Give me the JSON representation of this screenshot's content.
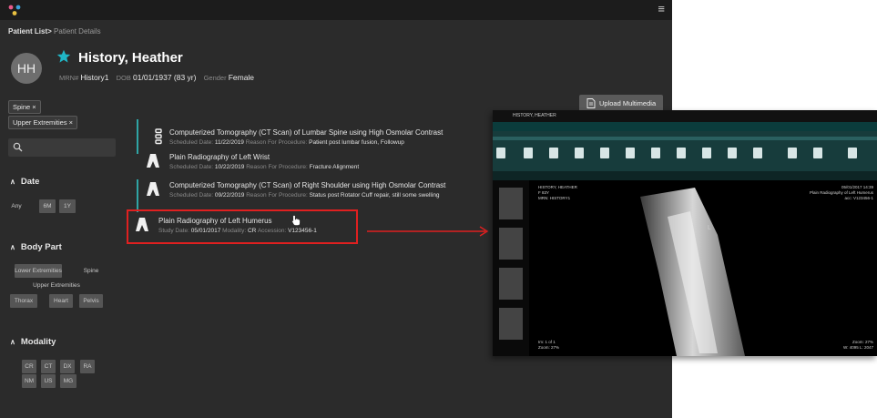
{
  "header": {
    "menu_icon": "hamburger-menu-icon",
    "logo_icon": "app-logo-icon"
  },
  "breadcrumb": {
    "link": "Patient List",
    "separator": ">",
    "current": "Patient Details"
  },
  "patient": {
    "initials": "HH",
    "name": "History, Heather",
    "mrn_label": "MRN#",
    "mrn": "History1",
    "dob_label": "DOB",
    "dob": "01/01/1937 (83 yr)",
    "gender_label": "Gender",
    "gender": "Female"
  },
  "filters": {
    "chips": [
      "Spine ×",
      "Upper Extremities ×"
    ],
    "date": {
      "title": "Date",
      "options": [
        "Any",
        "6M",
        "1Y"
      ]
    },
    "body_part": {
      "title": "Body Part",
      "options": [
        "Lower Extremities",
        "Spine",
        "Upper Extremities",
        "Thorax",
        "Heart",
        "Pelvis"
      ]
    },
    "modality": {
      "title": "Modality",
      "options": [
        "CR",
        "CT",
        "DX",
        "RA",
        "NM",
        "US",
        "MG"
      ]
    }
  },
  "upload_button": "Upload Multimedia",
  "studies": [
    {
      "title": "Computerized Tomography (CT Scan) of Lumbar Spine using High Osmolar Contrast",
      "label1": "Scheduled Date:",
      "value1": "11/22/2019",
      "label2": "Reason For Procedure:",
      "value2": "Patient post lumbar fusion, Followup"
    },
    {
      "title": "Plain Radiography of Left Wrist",
      "label1": "Scheduled Date:",
      "value1": "10/22/2019",
      "label2": "Reason For Procedure:",
      "value2": "Fracture Alignment"
    },
    {
      "title": "Computerized Tomography (CT Scan) of Right Shoulder using High Osmolar Contrast",
      "label1": "Scheduled Date:",
      "value1": "09/22/2019",
      "label2": "Reason For Procedure:",
      "value2": "Status post Rotator Cuff repair, still some swelling"
    },
    {
      "title": "Plain Radiography of Left Humerus",
      "label1": "Study Date:",
      "value1": "05/01/2017",
      "label2": "Modality:",
      "value2": "CR",
      "label3": "Accession:",
      "value3": "V123456-1"
    }
  ],
  "viewer": {
    "patient_tab": "HISTORY, HEATHER",
    "overlay_left": [
      "HISTORY, HEATHER",
      "F 83Y",
      "MRN: HISTORY1"
    ],
    "overlay_right": [
      "05/01/2017 14:39",
      "Plain Radiography of Left Humerus",
      "acc: V123456-1"
    ],
    "marker": "L",
    "bottom_left": [
      "Im: 1 of 1",
      "Zoom: 27%"
    ],
    "bottom_right": [
      "Zoom: 27%",
      "W: 4095 L: 2047"
    ]
  },
  "colors": {
    "accent_teal": "#2fa5a5",
    "highlight_red": "#e02020",
    "star_teal": "#20b7c7"
  }
}
